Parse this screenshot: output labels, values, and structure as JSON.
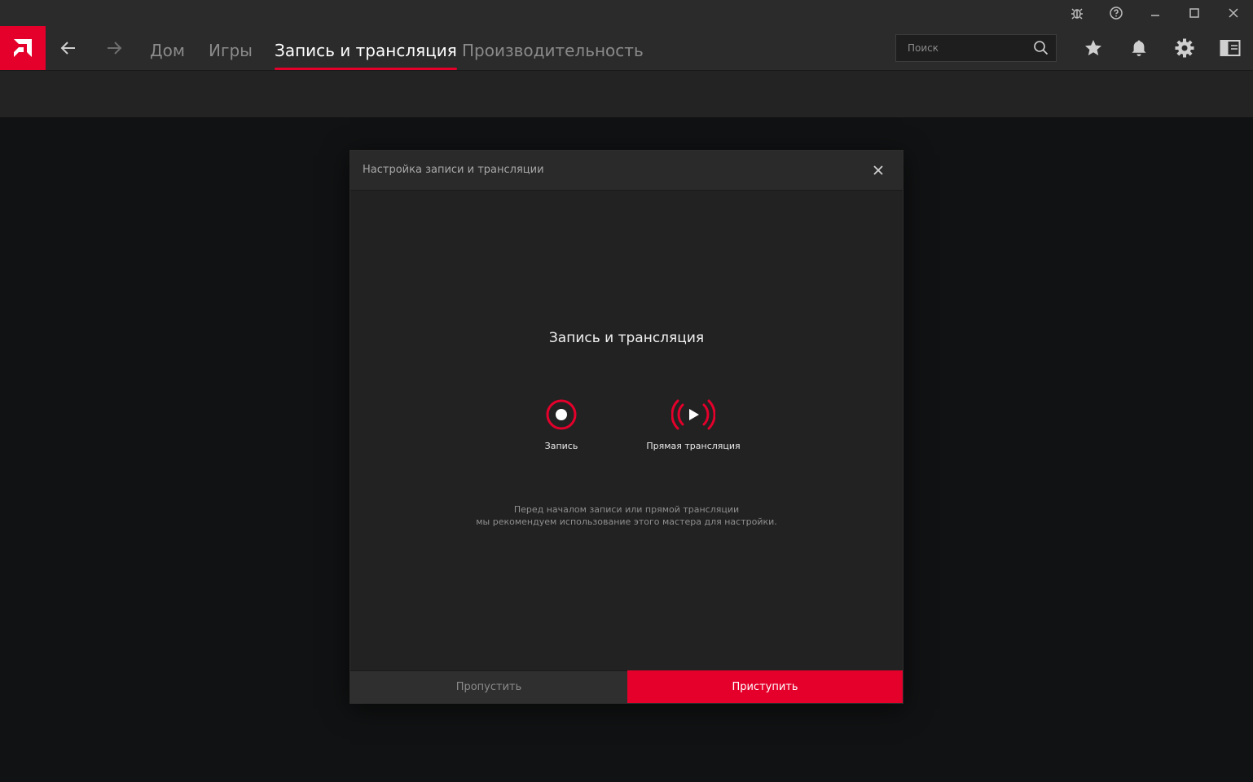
{
  "window_controls": [
    {
      "name": "bug-report-icon"
    },
    {
      "name": "help-icon"
    },
    {
      "name": "minimize-icon"
    },
    {
      "name": "maximize-icon"
    },
    {
      "name": "close-icon"
    }
  ],
  "nav": {
    "tabs": [
      {
        "label": "Дом",
        "active": false
      },
      {
        "label": "Игры",
        "active": false
      },
      {
        "label": "Запись и трансляция",
        "active": true
      },
      {
        "label": "Производительность",
        "active": false
      }
    ],
    "search_placeholder": "Поиск"
  },
  "toolbar_icons": [
    "star-icon",
    "bell-icon",
    "gear-icon",
    "panel-icon"
  ],
  "dialog": {
    "title": "Настройка записи и трансляции",
    "heading": "Запись и трансляция",
    "options": [
      {
        "label": "Запись",
        "icon": "record-icon"
      },
      {
        "label": "Прямая трансляция",
        "icon": "live-stream-icon"
      }
    ],
    "description_line1": "Перед началом записи или прямой трансляции",
    "description_line2": "мы рекомендуем использование этого мастера для настройки.",
    "skip_label": "Пропустить",
    "start_label": "Приступить"
  },
  "colors": {
    "accent": "#e4002b",
    "bar": "#2b2b2b",
    "background": "#111213"
  }
}
